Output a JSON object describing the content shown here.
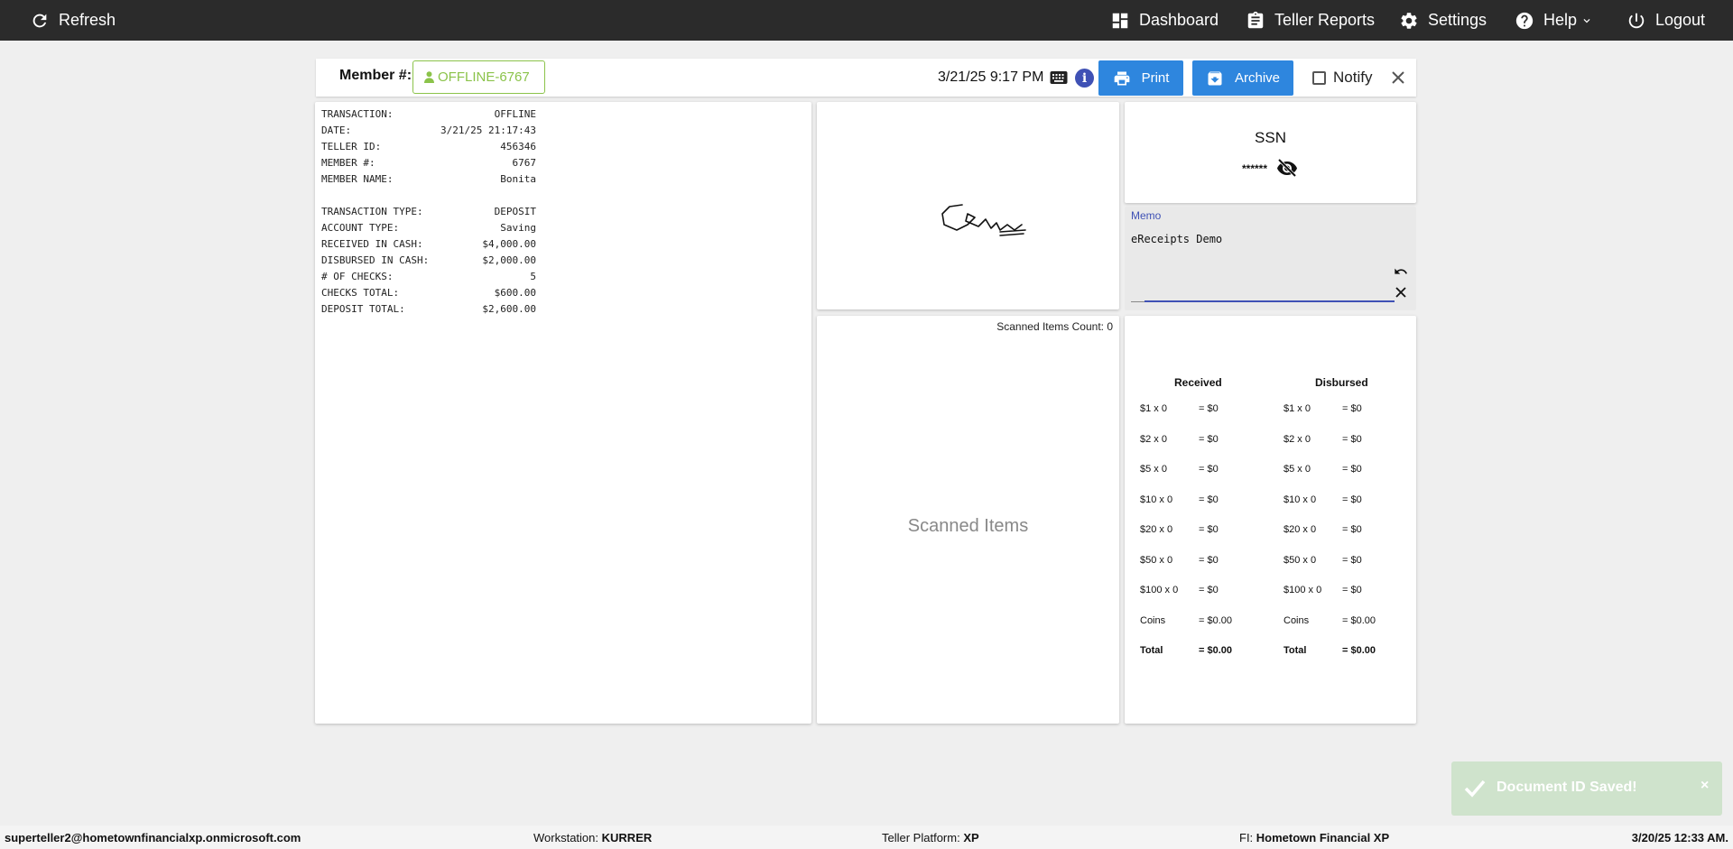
{
  "topbar": {
    "refresh_label": "Refresh",
    "dashboard_label": "Dashboard",
    "teller_reports_label": "Teller Reports",
    "settings_label": "Settings",
    "help_label": "Help",
    "logout_label": "Logout"
  },
  "header": {
    "member_label": "Member #:",
    "member_value": "OFFLINE-6767",
    "datetime": "3/21/25 9:17 PM",
    "print_label": "Print",
    "archive_label": "Archive",
    "notify_label": "Notify",
    "notify_checked": false
  },
  "receipt": {
    "rows": [
      {
        "key": "TRANSACTION:",
        "value": "OFFLINE"
      },
      {
        "key": "DATE:",
        "value": "3/21/25 21:17:43"
      },
      {
        "key": "TELLER ID:",
        "value": "456346"
      },
      {
        "key": "MEMBER #:",
        "value": "6767"
      },
      {
        "key": "MEMBER NAME:",
        "value": "Bonita"
      },
      {
        "key": "TRANSACTION TYPE:",
        "value": "DEPOSIT"
      },
      {
        "key": "ACCOUNT TYPE:",
        "value": "Saving"
      },
      {
        "key": "RECEIVED IN CASH:",
        "value": "$4,000.00"
      },
      {
        "key": "DISBURSED IN CASH:",
        "value": "$2,000.00"
      },
      {
        "key": "# OF CHECKS:",
        "value": "5"
      },
      {
        "key": "CHECKS TOTAL:",
        "value": "$600.00"
      },
      {
        "key": "DEPOSIT TOTAL:",
        "value": "$2,600.00"
      }
    ]
  },
  "scanned": {
    "count_text": "Scanned Items Count: 0",
    "placeholder": "Scanned Items"
  },
  "ssn": {
    "title": "SSN",
    "masked": "******"
  },
  "memo": {
    "label": "Memo",
    "value": "eReceipts Demo"
  },
  "cash": {
    "received_header": "Received",
    "disbursed_header": "Disbursed",
    "rows": [
      {
        "denom": "$1 x 0",
        "amount": "= $0"
      },
      {
        "denom": "$2 x 0",
        "amount": "= $0"
      },
      {
        "denom": "$5 x 0",
        "amount": "= $0"
      },
      {
        "denom": "$10 x 0",
        "amount": "= $0"
      },
      {
        "denom": "$20 x 0",
        "amount": "= $0"
      },
      {
        "denom": "$50 x 0",
        "amount": "= $0"
      },
      {
        "denom": "$100 x 0",
        "amount": "= $0"
      },
      {
        "denom": "Coins",
        "amount": "= $0.00"
      },
      {
        "denom": "Total",
        "amount": "= $0.00"
      }
    ]
  },
  "toast": {
    "message": "Document ID Saved!",
    "close": "×"
  },
  "footer": {
    "user": "superteller2@hometownfinancialxp.onmicrosoft.com",
    "workstation_label": "Workstation:",
    "workstation_value": "KURRER",
    "platform_label": "Teller Platform:",
    "platform_value": "XP",
    "fi_label": "FI:",
    "fi_value": "Hometown Financial XP",
    "date": "3/20/25 12:33 AM."
  },
  "colors": {
    "topbar": "#2b2b2b",
    "accent_blue": "#2e86de",
    "member_green": "#8bc34a",
    "memo_indigo": "#3f51b5",
    "toast_bg": "#cfe3cc"
  }
}
